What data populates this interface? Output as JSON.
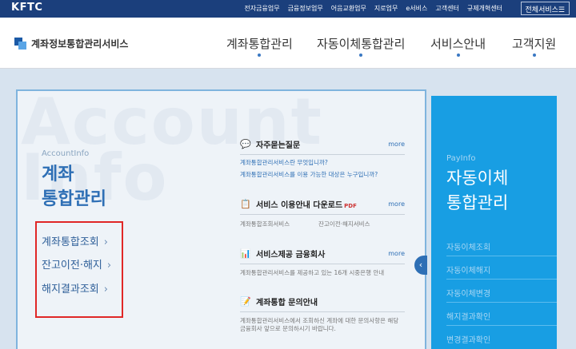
{
  "topbar": {
    "logo": "KFTC",
    "links": [
      "전자금융업무",
      "금융정보업무",
      "어음교환업무",
      "지로업무",
      "e서비스",
      "고객센터",
      "규제개혁센터"
    ],
    "all_services": "전체서비스☰"
  },
  "header": {
    "brand": "계좌정보통합관리서비스",
    "nav": [
      "계좌통합관리",
      "자동이체통합관리",
      "서비스안내",
      "고객지원"
    ]
  },
  "account_panel": {
    "watermark": "Account Info",
    "subtitle": "AccountInfo",
    "title_line1": "계좌",
    "title_line2": "통합관리",
    "menu": [
      "계좌통합조회",
      "잔고이전·해지",
      "해지결과조회"
    ],
    "chevron": "›"
  },
  "info": {
    "more": "more",
    "faq": {
      "title": "자주묻는질문",
      "items": [
        "계좌통합관리서비스란 무엇입니까?",
        "계좌통합관리서비스를 이용 가능한 대상은 누구입니까?"
      ]
    },
    "download": {
      "title": "서비스 이용안내 다운로드",
      "pdf": "PDF",
      "items": [
        "계좌통합조회서비스",
        "잔고이전·해지서비스"
      ]
    },
    "institutions": {
      "title": "서비스제공 금융회사",
      "desc": "계좌통합관리서비스를 제공하고 있는 16개 시중은행 안내"
    },
    "contact": {
      "title": "계좌통합 문의안내",
      "desc": "계좌통합관리서비스에서 조회하신 계좌에 대한 문의사항은 해당 금융회사 앞으로 문의하시기 바랍니다."
    }
  },
  "toggle": "‹",
  "payinfo": {
    "subtitle": "PayInfo",
    "title_line1": "자동이체",
    "title_line2": "통합관리",
    "links": [
      "자동이체조회",
      "자동이체해지",
      "자동이체변경",
      "해지결과확인",
      "변경결과확인"
    ]
  },
  "colors": {
    "topbar": "#1b3f7c",
    "accent": "#2e6fb5",
    "payinfo": "#189ee3",
    "highlight": "#e02727"
  }
}
